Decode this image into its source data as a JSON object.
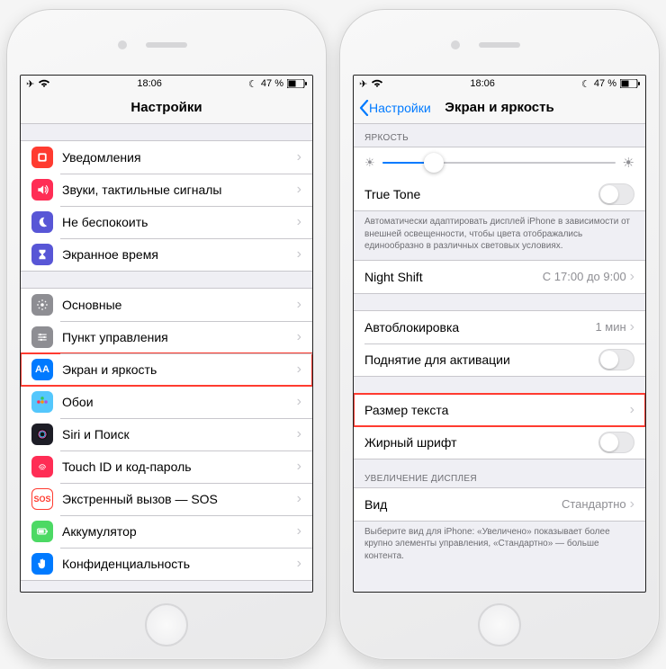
{
  "status": {
    "time": "18:06",
    "battery": "47 %"
  },
  "left": {
    "title": "Настройки",
    "section1": [
      {
        "id": "notifications",
        "label": "Уведомления",
        "color": "#ff3b30",
        "glyph": "bell"
      },
      {
        "id": "sounds",
        "label": "Звуки, тактильные сигналы",
        "color": "#ff2d55",
        "glyph": "speaker"
      },
      {
        "id": "dnd",
        "label": "Не беспокоить",
        "color": "#5856d6",
        "glyph": "moon"
      },
      {
        "id": "screentime",
        "label": "Экранное время",
        "color": "#5856d6",
        "glyph": "hourglass"
      }
    ],
    "section2": [
      {
        "id": "general",
        "label": "Основные",
        "color": "#8e8e93",
        "glyph": "gear"
      },
      {
        "id": "controlcenter",
        "label": "Пункт управления",
        "color": "#8e8e93",
        "glyph": "sliders"
      },
      {
        "id": "display",
        "label": "Экран и яркость",
        "color": "#007aff",
        "glyph": "AA",
        "highlight": true
      },
      {
        "id": "wallpaper",
        "label": "Обои",
        "color": "#54c7fc",
        "glyph": "flower"
      },
      {
        "id": "siri",
        "label": "Siri и Поиск",
        "color": "#1d1d26",
        "glyph": "siri"
      },
      {
        "id": "touchid",
        "label": "Touch ID и код-пароль",
        "color": "#ff2d55",
        "glyph": "fingerprint"
      },
      {
        "id": "sos",
        "label": "Экстренный вызов — SOS",
        "color": "#ffffff",
        "glyph": "SOS"
      },
      {
        "id": "battery",
        "label": "Аккумулятор",
        "color": "#4cd964",
        "glyph": "battery"
      },
      {
        "id": "privacy",
        "label": "Конфиденциальность",
        "color": "#007aff",
        "glyph": "hand"
      }
    ]
  },
  "right": {
    "back": "Настройки",
    "title": "Экран и яркость",
    "brightness_header": "ЯРКОСТЬ",
    "brightness_pct": 22,
    "truetone_label": "True Tone",
    "truetone_desc": "Автоматически адаптировать дисплей iPhone в зависимости от внешней освещенности, чтобы цвета отображались единообразно в различных световых условиях.",
    "nightshift_label": "Night Shift",
    "nightshift_value": "С 17:00 до 9:00",
    "autolock_label": "Автоблокировка",
    "autolock_value": "1 мин",
    "raise_label": "Поднятие для активации",
    "textsize_label": "Размер текста",
    "bold_label": "Жирный шрифт",
    "zoom_header": "УВЕЛИЧЕНИЕ ДИСПЛЕЯ",
    "zoom_label": "Вид",
    "zoom_value": "Стандартно",
    "zoom_desc": "Выберите вид для iPhone: «Увеличено» показывает более крупно элементы управления, «Стандартно» — больше контента."
  }
}
